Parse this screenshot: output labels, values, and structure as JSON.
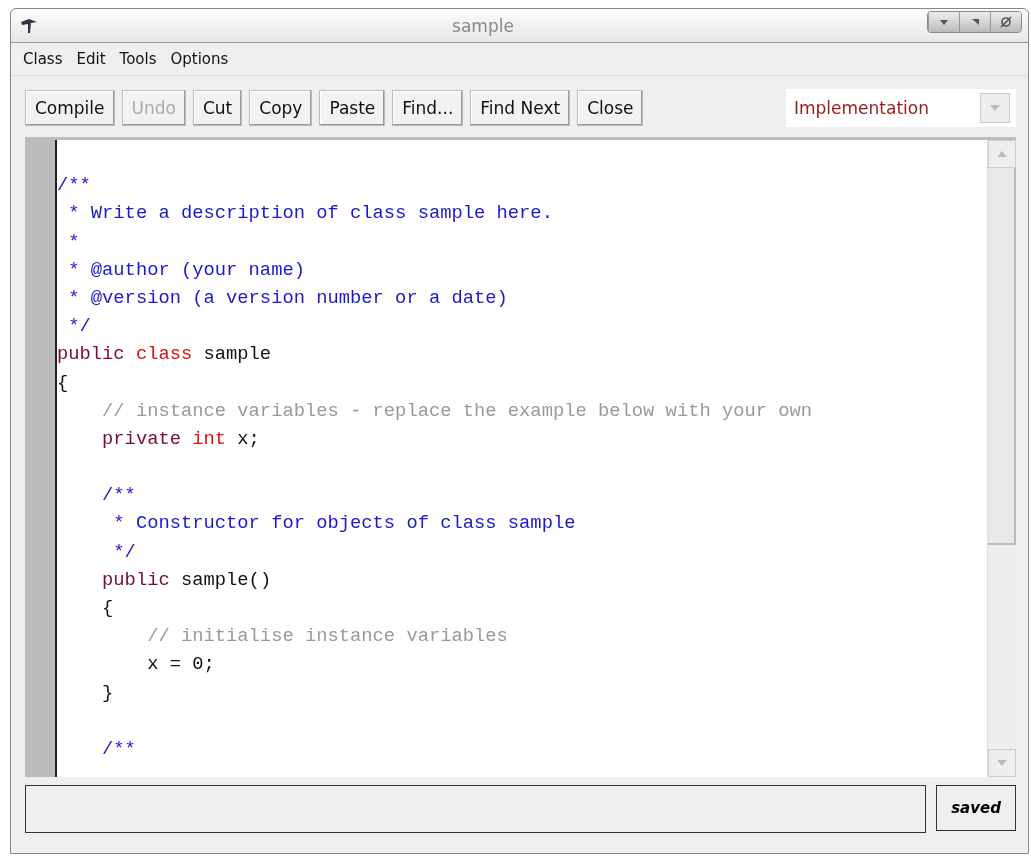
{
  "window": {
    "title": "sample"
  },
  "menu": [
    "Class",
    "Edit",
    "Tools",
    "Options"
  ],
  "toolbar": [
    {
      "label": "Compile",
      "disabled": false
    },
    {
      "label": "Undo",
      "disabled": true
    },
    {
      "label": "Cut",
      "disabled": false
    },
    {
      "label": "Copy",
      "disabled": false
    },
    {
      "label": "Paste",
      "disabled": false
    },
    {
      "label": "Find...",
      "disabled": false
    },
    {
      "label": "Find Next",
      "disabled": false
    },
    {
      "label": "Close",
      "disabled": false
    }
  ],
  "view_selector": {
    "value": "Implementation"
  },
  "code_lines": [
    {
      "kind": "blank"
    },
    {
      "kind": "code",
      "tokens": [
        {
          "kind": "doc",
          "text": "/**"
        }
      ]
    },
    {
      "kind": "code",
      "tokens": [
        {
          "kind": "doc",
          "text": " * Write a description of class sample here."
        }
      ]
    },
    {
      "kind": "code",
      "tokens": [
        {
          "kind": "doc",
          "text": " *"
        }
      ]
    },
    {
      "kind": "code",
      "tokens": [
        {
          "kind": "doc",
          "text": " * @author (your name)"
        }
      ]
    },
    {
      "kind": "code",
      "tokens": [
        {
          "kind": "doc",
          "text": " * @version (a version number or a date)"
        }
      ]
    },
    {
      "kind": "code",
      "tokens": [
        {
          "kind": "doc",
          "text": " */"
        }
      ]
    },
    {
      "kind": "code",
      "tokens": [
        {
          "kind": "keyword",
          "text": "public"
        },
        {
          "kind": "type",
          "text": " class"
        },
        {
          "kind": "plain",
          "text": " sample"
        }
      ]
    },
    {
      "kind": "code",
      "tokens": [
        {
          "kind": "plain",
          "text": "{"
        }
      ]
    },
    {
      "kind": "code",
      "tokens": [
        {
          "kind": "comment",
          "text": "    // instance variables - replace the example below with your own"
        }
      ]
    },
    {
      "kind": "code",
      "tokens": [
        {
          "kind": "keyword",
          "text": "    private"
        },
        {
          "kind": "type",
          "text": " int"
        },
        {
          "kind": "plain",
          "text": " x;"
        }
      ]
    },
    {
      "kind": "blank"
    },
    {
      "kind": "code",
      "tokens": [
        {
          "kind": "doc",
          "text": "    /**"
        }
      ]
    },
    {
      "kind": "code",
      "tokens": [
        {
          "kind": "doc",
          "text": "     * Constructor for objects of class sample"
        }
      ]
    },
    {
      "kind": "code",
      "tokens": [
        {
          "kind": "doc",
          "text": "     */"
        }
      ]
    },
    {
      "kind": "code",
      "tokens": [
        {
          "kind": "keyword",
          "text": "    public"
        },
        {
          "kind": "plain",
          "text": " sample()"
        }
      ]
    },
    {
      "kind": "code",
      "tokens": [
        {
          "kind": "plain",
          "text": "    {"
        }
      ]
    },
    {
      "kind": "code",
      "tokens": [
        {
          "kind": "comment",
          "text": "        // initialise instance variables"
        }
      ]
    },
    {
      "kind": "code",
      "tokens": [
        {
          "kind": "plain",
          "text": "        x = 0;"
        }
      ]
    },
    {
      "kind": "code",
      "tokens": [
        {
          "kind": "plain",
          "text": "    }"
        }
      ]
    },
    {
      "kind": "blank"
    },
    {
      "kind": "code",
      "tokens": [
        {
          "kind": "doc",
          "text": "    /**"
        }
      ]
    }
  ],
  "status_bar": {
    "state": "saved"
  }
}
